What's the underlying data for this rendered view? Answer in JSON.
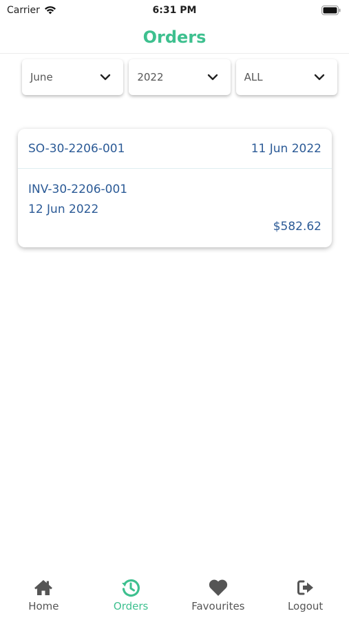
{
  "status_bar": {
    "carrier": "Carrier",
    "time": "6:31 PM"
  },
  "nav": {
    "title": "Orders",
    "title_color": "#3ec08f"
  },
  "filters": {
    "month": "June",
    "year": "2022",
    "status": "ALL"
  },
  "orders": [
    {
      "order_no": "SO-30-2206-001",
      "order_date": "11 Jun 2022",
      "invoice_no": "INV-30-2206-001",
      "invoice_date": "12 Jun 2022",
      "amount": "$582.62"
    }
  ],
  "tab_bar": {
    "items": [
      {
        "label": "Home",
        "icon": "home-icon",
        "active": false
      },
      {
        "label": "Orders",
        "icon": "history-icon",
        "active": true
      },
      {
        "label": "Favourites",
        "icon": "heart-icon",
        "active": false
      },
      {
        "label": "Logout",
        "icon": "logout-icon",
        "active": false
      }
    ],
    "active_color": "#3ec08f",
    "inactive_color": "#555555"
  },
  "colors": {
    "accent": "#3ec08f",
    "text_blue": "#2b5a96"
  }
}
